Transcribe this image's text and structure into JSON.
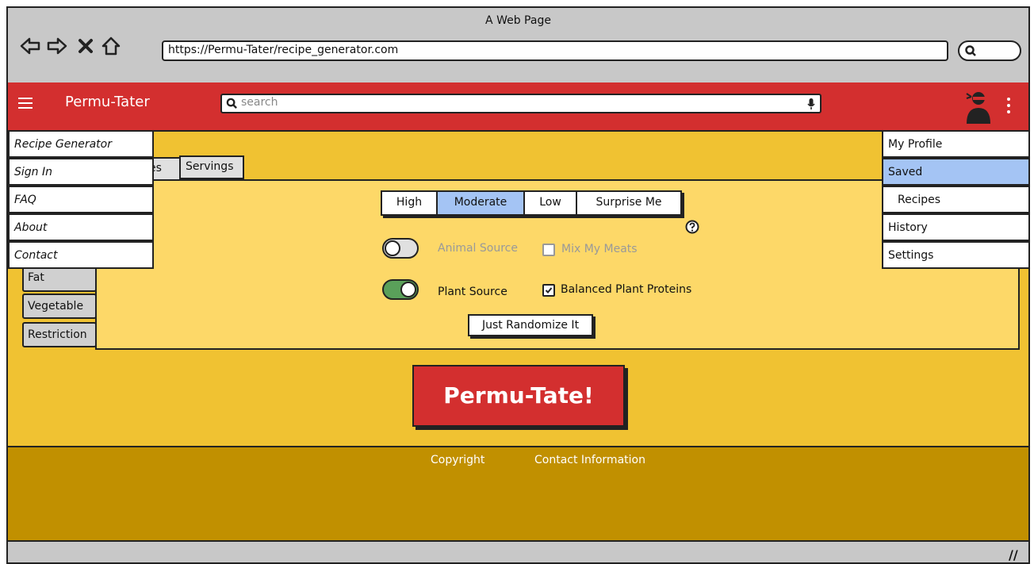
{
  "browser": {
    "window_title": "A Web Page",
    "url": "https://Permu-Tater/recipe_generator.com",
    "nav_icons": [
      "back-icon",
      "forward-icon",
      "close-icon",
      "home-icon"
    ]
  },
  "header": {
    "brand": "Permu-Tater",
    "search_placeholder": "search",
    "color": "#d32f2f"
  },
  "left_menu": {
    "items": [
      "Recipe Generator",
      "Sign In",
      "FAQ",
      "About",
      "Contact"
    ]
  },
  "right_menu": {
    "items": [
      "My Profile",
      "Saved",
      "Recipes",
      "History",
      "Settings"
    ],
    "selected": "Saved"
  },
  "tabs": {
    "partial": "es",
    "servings": "Servings"
  },
  "side_tabs": [
    "Fat",
    "Vegetable",
    "Restriction"
  ],
  "level_options": {
    "items": [
      "High",
      "Moderate",
      "Low",
      "Surprise Me"
    ],
    "selected": "Moderate"
  },
  "protein": {
    "animal_label": "Animal Source",
    "animal_on": false,
    "mix_meats_label": "Mix My Meats",
    "mix_meats_checked": false,
    "plant_label": "Plant Source",
    "plant_on": true,
    "balanced_label": "Balanced Plant Proteins",
    "balanced_checked": true
  },
  "randomize_label": "Just Randomize It",
  "go_label": "Permu-Tate!",
  "footer": {
    "copyright": "Copyright",
    "contact": "Contact Information"
  },
  "colors": {
    "main_bg": "#f0c232",
    "panel_bg": "#fdd868",
    "footer_bg": "#c19000",
    "selected": "#a4c4f4",
    "toggle_on": "#5aa05a"
  }
}
